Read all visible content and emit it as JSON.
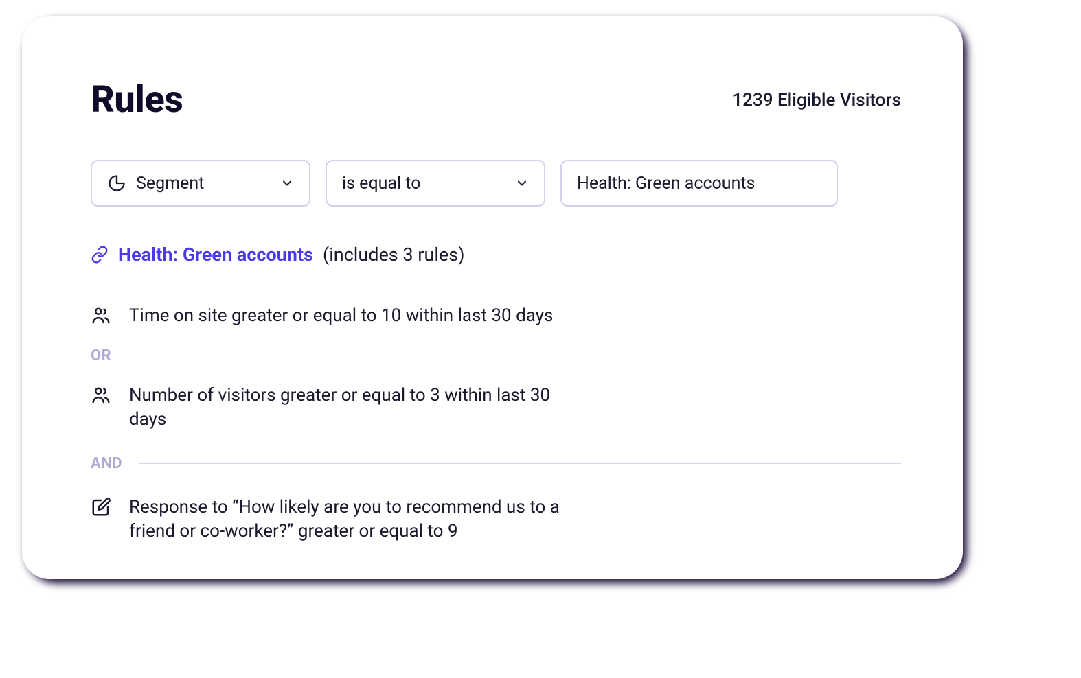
{
  "header": {
    "title": "Rules",
    "eligible_label": "1239 Eligible Visitors"
  },
  "selectors": {
    "attribute": {
      "label": "Segment"
    },
    "operator": {
      "label": "is equal to"
    },
    "value": {
      "label": "Health: Green accounts"
    }
  },
  "segment_link": {
    "name": "Health: Green accounts",
    "suffix": "(includes 3 rules)"
  },
  "rules": [
    {
      "text": "Time on site greater or equal to 10 within last 30 days"
    },
    {
      "text": "Number of visitors greater or equal to 3 within last 30 days"
    },
    {
      "text": "Response to “How likely are you to recommend us to a friend or co-worker?” greater or equal to 9"
    }
  ],
  "logic": {
    "or": "OR",
    "and": "AND"
  }
}
